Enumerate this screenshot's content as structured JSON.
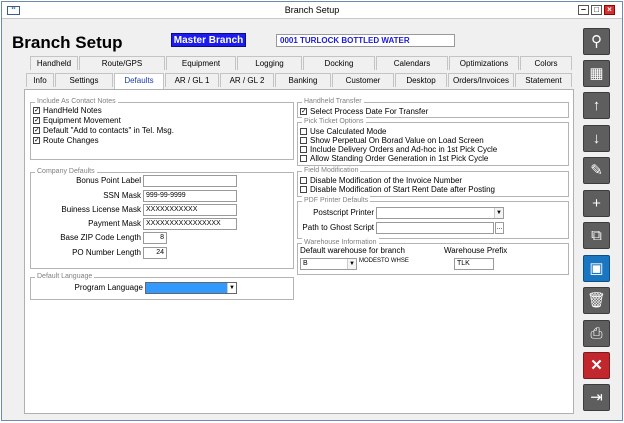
{
  "window": {
    "title": "Branch Setup",
    "icon_text": "**"
  },
  "header": {
    "page_title": "Branch Setup",
    "master_button": "Master Branch",
    "company": "0001  TURLOCK BOTTLED WATER"
  },
  "tabs_row1": [
    "Handheld",
    "Route/GPS",
    "Equipment",
    "Logging",
    "Docking",
    "Calendars",
    "Optimizations",
    "Colors"
  ],
  "tabs_row2": [
    "Info",
    "Settings",
    "Defaults",
    "AR / GL 1",
    "AR / GL 2",
    "Banking",
    "Customer",
    "Desktop",
    "Orders/Invoices",
    "Statement"
  ],
  "active_tab": "Defaults",
  "contact_notes": {
    "title": "Include As Contact Notes",
    "items": [
      {
        "label": "HandHeld Notes",
        "checked": true
      },
      {
        "label": "Equipment Movement",
        "checked": true
      },
      {
        "label": "Default \"Add to contacts\" in Tel. Msg.",
        "checked": true
      },
      {
        "label": "Route Changes",
        "checked": true
      }
    ]
  },
  "company_defaults": {
    "title": "Company Defaults",
    "bonus_point_label": {
      "label": "Bonus Point Label",
      "value": ""
    },
    "ssn_mask": {
      "label": "SSN Mask",
      "value": "999-99-9999"
    },
    "business_license_mask": {
      "label": "Buiness License Mask",
      "value": "XXXXXXXXXXX"
    },
    "payment_mask": {
      "label": "Payment Mask",
      "value": "XXXXXXXXXXXXXXXX"
    },
    "base_zip_length": {
      "label": "Base ZIP Code Length",
      "value": "8"
    },
    "po_number_length": {
      "label": "PO Number Length",
      "value": "24"
    }
  },
  "default_language": {
    "title": "Default Language",
    "label": "Program Language",
    "value": ""
  },
  "handheld_transfer": {
    "title": "Handheld Transfer",
    "items": [
      {
        "label": "Select Process Date For Transfer",
        "checked": true
      }
    ]
  },
  "pick_ticket": {
    "title": "Pick Ticket Options",
    "items": [
      {
        "label": "Use Calculated Mode",
        "checked": false
      },
      {
        "label": "Show Perpetual On Borad Value on Load Screen",
        "checked": false
      },
      {
        "label": "Include Delivery Orders and Ad-hoc in 1st Pick Cycle",
        "checked": false
      },
      {
        "label": "Allow Standing Order Generation in 1st Pick Cycle",
        "checked": false
      }
    ]
  },
  "field_modification": {
    "title": "Field Modification",
    "items": [
      {
        "label": "Disable Modification of the Invoice Number",
        "checked": false
      },
      {
        "label": "Disable Modification of Start Rent Date after Posting",
        "checked": false
      }
    ]
  },
  "pdf_printer": {
    "title": "PDF Printer Defaults",
    "postscript_printer": {
      "label": "Postscript Printer",
      "value": ""
    },
    "ghost_script": {
      "label": "Path to Ghost Script",
      "value": "",
      "browse": "..."
    }
  },
  "warehouse": {
    "title": "Warehouse Information",
    "default_label": "Default warehouse for branch",
    "default_value": "B",
    "default_desc": "MODESTO WHSE",
    "prefix_label": "Warehouse Prefix",
    "prefix_value": "TLK"
  },
  "toolbar": {
    "search": "⚲",
    "list": "▦",
    "up": "↑",
    "down": "↓",
    "edit": "✎",
    "add": "+",
    "copy": "⧉",
    "save": "▣",
    "delete": "🗑",
    "print": "⎙",
    "cancel": "✕",
    "exit": "⇥"
  },
  "colors": {
    "master_button": "#1c1cf0",
    "company_text": "#1c1cd8",
    "save_button": "#1a76c0",
    "cancel_button": "#c1272d"
  }
}
